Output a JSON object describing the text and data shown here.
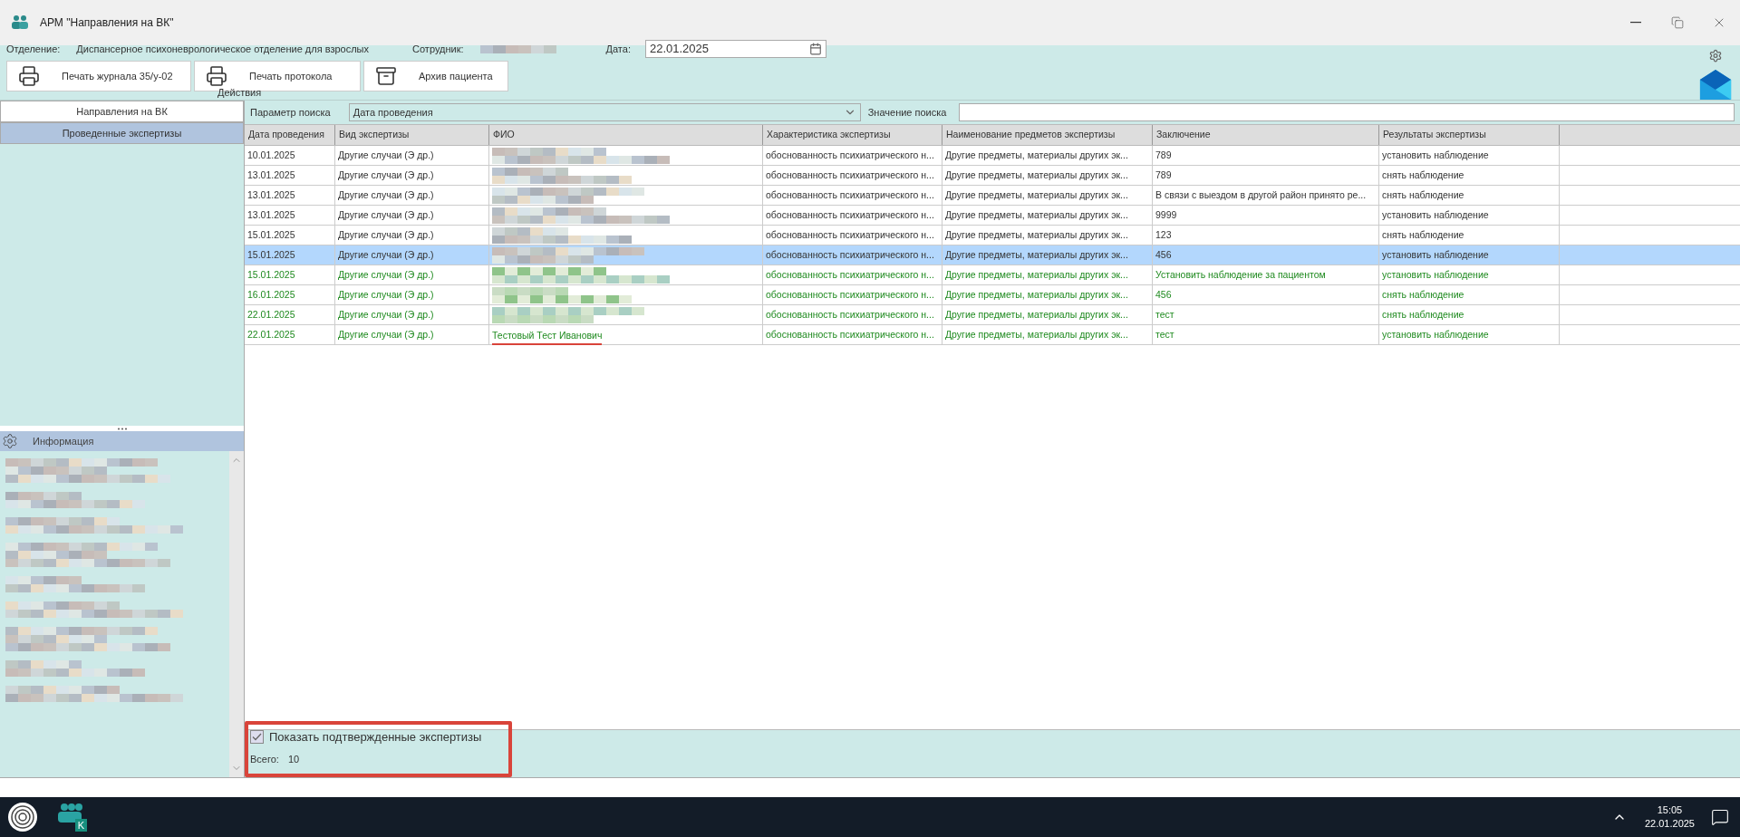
{
  "window": {
    "title": "АРМ \"Направления на ВК\""
  },
  "header": {
    "department_label": "Отделение:",
    "department": "Диспансерное психоневрологическое отделение для взрослых",
    "employee_label": "Сотрудник:",
    "date_label": "Дата:",
    "date": "22.01.2025"
  },
  "actions": {
    "label": "Действия",
    "buttons": [
      {
        "label": "Печать журнала 35/у-02",
        "kind": "journal"
      },
      {
        "label": "Печать протокола",
        "kind": "protocol"
      },
      {
        "label": "Архив пациента",
        "kind": "archive"
      }
    ]
  },
  "left_tabs": [
    {
      "label": "Направления на ВК",
      "selected": false
    },
    {
      "label": "Проведенные экспертизы",
      "selected": true
    }
  ],
  "info_panel": {
    "title": "Информация"
  },
  "search": {
    "param_label": "Параметр поиска",
    "param_value": "Дата проведения",
    "value_label": "Значение поиска"
  },
  "table": {
    "columns": [
      "Дата проведения",
      "Вид экспертизы",
      "ФИО",
      "Характеристика экспертизы",
      "Наименование предметов экспертизы",
      "Заключение",
      "Результаты экспертизы"
    ],
    "rows": [
      {
        "cells": [
          "10.01.2025",
          "Другие случаи (Э др.)",
          null,
          "обоснованность психиатрического н...",
          "Другие предметы, материалы других эк...",
          "789",
          "установить наблюдение"
        ],
        "selected": false,
        "confirmed": false
      },
      {
        "cells": [
          "13.01.2025",
          "Другие случаи (Э др.)",
          null,
          "обоснованность психиатрического н...",
          "Другие предметы, материалы других эк...",
          "789",
          "снять наблюдение"
        ],
        "selected": false,
        "confirmed": false
      },
      {
        "cells": [
          "13.01.2025",
          "Другие случаи (Э др.)",
          null,
          "обоснованность психиатрического н...",
          "Другие предметы, материалы других эк...",
          "В связи с выездом в другой район принято ре...",
          "снять наблюдение"
        ],
        "selected": false,
        "confirmed": false
      },
      {
        "cells": [
          "13.01.2025",
          "Другие случаи (Э др.)",
          null,
          "обоснованность психиатрического н...",
          "Другие предметы, материалы других эк...",
          "9999",
          "установить наблюдение"
        ],
        "selected": false,
        "confirmed": false
      },
      {
        "cells": [
          "15.01.2025",
          "Другие случаи (Э др.)",
          null,
          "обоснованность психиатрического н...",
          "Другие предметы, материалы других эк...",
          "123",
          "снять наблюдение"
        ],
        "selected": false,
        "confirmed": false
      },
      {
        "cells": [
          "15.01.2025",
          "Другие случаи (Э др.)",
          null,
          "обоснованность психиатрического н...",
          "Другие предметы, материалы других эк...",
          "456",
          "установить наблюдение"
        ],
        "selected": true,
        "confirmed": false
      },
      {
        "cells": [
          "15.01.2025",
          "Другие случаи (Э др.)",
          null,
          "обоснованность психиатрического н...",
          "Другие предметы, материалы других эк...",
          "Установить наблюдение за пациентом",
          "установить наблюдение"
        ],
        "selected": false,
        "confirmed": true
      },
      {
        "cells": [
          "16.01.2025",
          "Другие случаи (Э др.)",
          null,
          "обоснованность психиатрического н...",
          "Другие предметы, материалы других эк...",
          "456",
          "снять наблюдение"
        ],
        "selected": false,
        "confirmed": true
      },
      {
        "cells": [
          "22.01.2025",
          "Другие случаи (Э др.)",
          null,
          "обоснованность психиатрического н...",
          "Другие предметы, материалы других эк...",
          "тест",
          "снять наблюдение"
        ],
        "selected": false,
        "confirmed": true
      },
      {
        "cells": [
          "22.01.2025",
          "Другие случаи (Э др.)",
          "Тестовый Тест Иванович",
          "обоснованность психиатрического н...",
          "Другие предметы, материалы других эк...",
          "тест",
          "установить наблюдение"
        ],
        "selected": false,
        "confirmed": true
      }
    ]
  },
  "footer": {
    "checkbox": {
      "label": "Показать подтвержденные экспертизы",
      "checked": true
    },
    "total_label": "Всего:",
    "total": "10"
  },
  "taskbar": {
    "app_badge": "K",
    "time": "15:05",
    "date": "22.01.2025"
  }
}
